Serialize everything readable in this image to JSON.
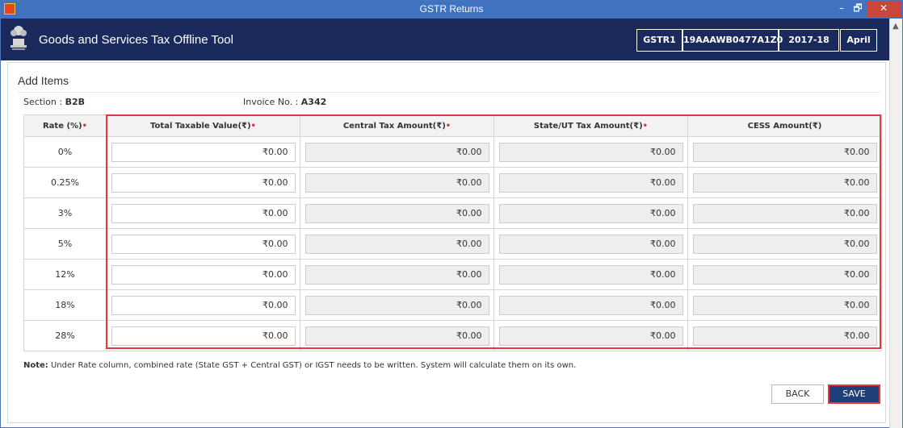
{
  "window": {
    "title": "GSTR Returns",
    "min_glyph": "–",
    "max_glyph": "🗗",
    "close_glyph": "✕"
  },
  "header": {
    "app_name": "Goods and Services Tax Offline Tool",
    "form": "GSTR1",
    "gstin": "19AAAWB0477A1Z0",
    "year": "2017-18",
    "month": "April"
  },
  "page": {
    "title": "Add Items",
    "section_label": "Section :",
    "section_value": "B2B",
    "invoice_label": "Invoice No. :",
    "invoice_value": "A342"
  },
  "table": {
    "headers": {
      "rate": "Rate (%)",
      "taxable": "Total Taxable Value(₹)",
      "central": "Central Tax Amount(₹)",
      "state": "State/UT Tax Amount(₹)",
      "cess": "CESS Amount(₹)"
    },
    "required_mark": "•",
    "rows": [
      {
        "rate": "0%",
        "taxable": "₹0.00",
        "central": "₹0.00",
        "state": "₹0.00",
        "cess": "₹0.00"
      },
      {
        "rate": "0.25%",
        "taxable": "₹0.00",
        "central": "₹0.00",
        "state": "₹0.00",
        "cess": "₹0.00"
      },
      {
        "rate": "3%",
        "taxable": "₹0.00",
        "central": "₹0.00",
        "state": "₹0.00",
        "cess": "₹0.00"
      },
      {
        "rate": "5%",
        "taxable": "₹0.00",
        "central": "₹0.00",
        "state": "₹0.00",
        "cess": "₹0.00"
      },
      {
        "rate": "12%",
        "taxable": "₹0.00",
        "central": "₹0.00",
        "state": "₹0.00",
        "cess": "₹0.00"
      },
      {
        "rate": "18%",
        "taxable": "₹0.00",
        "central": "₹0.00",
        "state": "₹0.00",
        "cess": "₹0.00"
      },
      {
        "rate": "28%",
        "taxable": "₹0.00",
        "central": "₹0.00",
        "state": "₹0.00",
        "cess": "₹0.00"
      }
    ]
  },
  "note": {
    "label": "Note:",
    "text": " Under Rate column, combined rate (State GST + Central GST) or IGST needs to be written. System will calculate them on its own."
  },
  "buttons": {
    "back": "BACK",
    "save": "SAVE"
  },
  "colors": {
    "titlebar": "#3f72c0",
    "header": "#1b2a5c",
    "highlight": "#e53939",
    "save": "#1f3e7a"
  },
  "icons": [
    "app-icon",
    "emblem-icon",
    "minimize-icon",
    "maximize-icon",
    "close-icon",
    "scroll-up-icon"
  ]
}
